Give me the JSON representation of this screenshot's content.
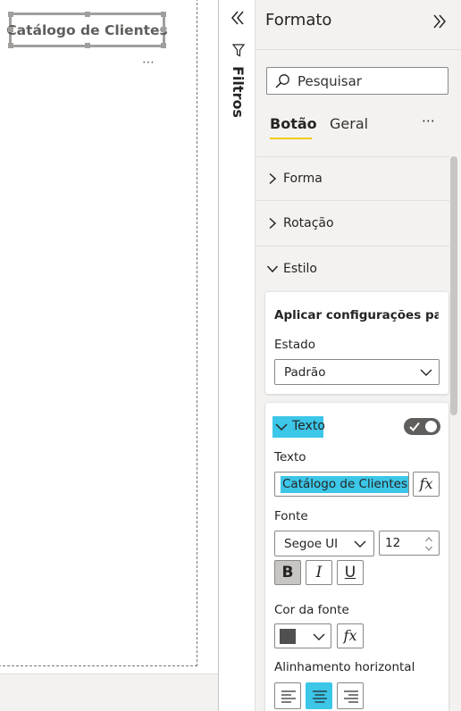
{
  "canvas": {
    "visual_title": "Catálogo de Clientes",
    "more_options": "⋯"
  },
  "filters": {
    "label": "Filtros"
  },
  "format_pane": {
    "title": "Formato",
    "search_placeholder": "Pesquisar",
    "tabs": [
      {
        "label": "Botão",
        "active": true
      },
      {
        "label": "Geral",
        "active": false
      }
    ],
    "more_options": "⋯",
    "sections": [
      {
        "label": "Forma",
        "expanded": false
      },
      {
        "label": "Rotação",
        "expanded": false
      },
      {
        "label": "Estilo",
        "expanded": true
      }
    ],
    "apply_card": {
      "title": "Aplicar configurações pa...",
      "state_label": "Estado",
      "state_value": "Padrão"
    },
    "text_card": {
      "header": "Texto",
      "toggle_on": true,
      "text_label": "Texto",
      "text_value": "Catálogo de Clientes",
      "fx_label": "fx",
      "font_label": "Fonte",
      "font_value": "Segoe UI",
      "font_size": "12",
      "bold_label": "B",
      "italic_label": "I",
      "underline_label": "U",
      "bold_active": true,
      "font_color_label": "Cor da fonte",
      "font_color": "#505050",
      "align_label": "Alinhamento horizontal",
      "align_selected": "center"
    }
  },
  "colors": {
    "accent_yellow": "#f2c811",
    "highlight_cyan": "#3cc6e8",
    "pane_bg": "#f3f2f1"
  }
}
